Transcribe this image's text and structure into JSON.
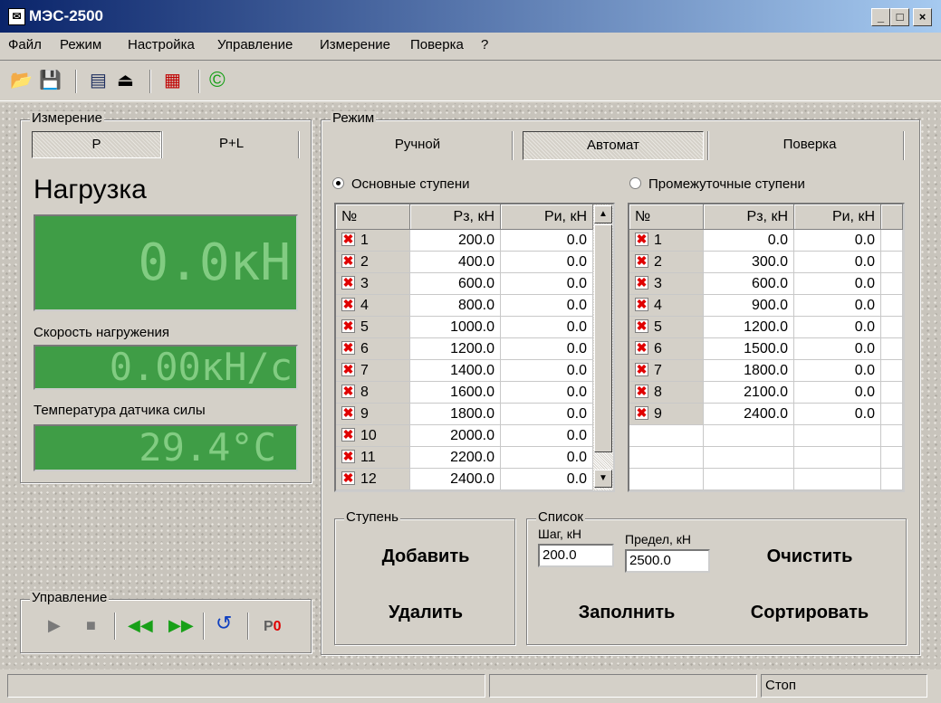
{
  "window": {
    "title": "МЭС-2500",
    "app_icon": "chart-icon",
    "minimize": "_",
    "maximize": "□",
    "close": "×"
  },
  "menu": [
    "Файл",
    "Режим",
    "Настройка",
    "Управление",
    "Измерение",
    "Поверка",
    "?"
  ],
  "toolbar": [
    "open-folder-icon",
    "save-disk-icon",
    "report-icon",
    "printer-icon",
    "device-reset-icon",
    "copyright-icon"
  ],
  "measurement": {
    "group_label": "Измерение",
    "tabs": [
      "P",
      "P+L"
    ],
    "active_tab": "P",
    "load_title": "Нагрузка",
    "load_value": "0.0кН",
    "speed_label": "Скорость нагружения",
    "speed_value": "0.00кН/с",
    "temp_label": "Температура датчика силы",
    "temp_value": "29.4°C",
    "lcd_color": "#3f9d46"
  },
  "control": {
    "group_label": "Управление",
    "buttons": [
      "play-icon",
      "stop-icon",
      "rewind-icon",
      "fast-forward-icon",
      "refresh-icon",
      "P0"
    ]
  },
  "mode": {
    "group_label": "Режим",
    "tabs": [
      "Ручной",
      "Автомат",
      "Поверка"
    ],
    "active_tab": "Автомат",
    "radio_main": "Основные ступени",
    "radio_intermediate": "Промежуточные ступени",
    "selected_radio": "main"
  },
  "main_steps": {
    "headers": [
      "№",
      "Рз, кН",
      "Ри, кН"
    ],
    "rows": [
      [
        "1",
        "200.0",
        "0.0"
      ],
      [
        "2",
        "400.0",
        "0.0"
      ],
      [
        "3",
        "600.0",
        "0.0"
      ],
      [
        "4",
        "800.0",
        "0.0"
      ],
      [
        "5",
        "1000.0",
        "0.0"
      ],
      [
        "6",
        "1200.0",
        "0.0"
      ],
      [
        "7",
        "1400.0",
        "0.0"
      ],
      [
        "8",
        "1600.0",
        "0.0"
      ],
      [
        "9",
        "1800.0",
        "0.0"
      ],
      [
        "10",
        "2000.0",
        "0.0"
      ],
      [
        "11",
        "2200.0",
        "0.0"
      ],
      [
        "12",
        "2400.0",
        "0.0"
      ]
    ],
    "check_mark": "✖"
  },
  "intermediate_steps": {
    "headers": [
      "№",
      "Рз, кН",
      "Ри, кН"
    ],
    "rows": [
      [
        "1",
        "0.0",
        "0.0"
      ],
      [
        "2",
        "300.0",
        "0.0"
      ],
      [
        "3",
        "600.0",
        "0.0"
      ],
      [
        "4",
        "900.0",
        "0.0"
      ],
      [
        "5",
        "1200.0",
        "0.0"
      ],
      [
        "6",
        "1500.0",
        "0.0"
      ],
      [
        "7",
        "1800.0",
        "0.0"
      ],
      [
        "8",
        "2100.0",
        "0.0"
      ],
      [
        "9",
        "2400.0",
        "0.0"
      ]
    ]
  },
  "step_group": {
    "label": "Ступень",
    "add": "Добавить",
    "delete": "Удалить"
  },
  "list_group": {
    "label": "Список",
    "step_label": "Шаг, кН",
    "step_value": "200.0",
    "limit_label": "Предел, кН",
    "limit_value": "2500.0",
    "clear": "Очистить",
    "fill": "Заполнить",
    "sort": "Сортировать"
  },
  "status": {
    "panels": [
      "",
      "",
      "Стоп"
    ]
  }
}
